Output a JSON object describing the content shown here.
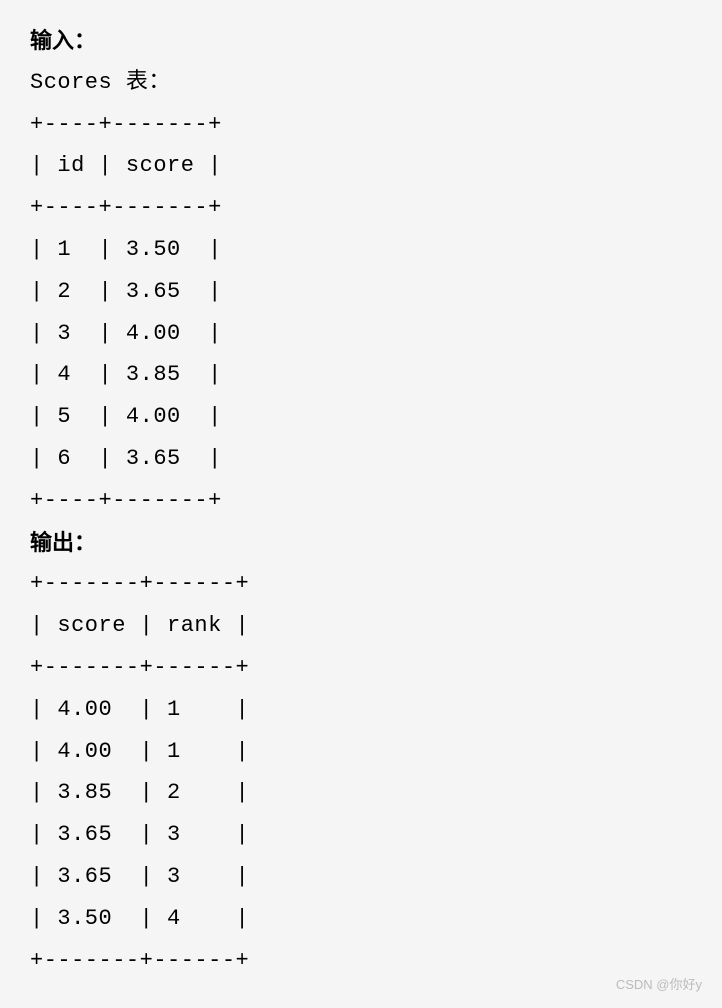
{
  "section1": {
    "heading": "输入：",
    "table_label": "Scores 表：",
    "divider_top": "+----+-------+",
    "header_row": "| id | score |",
    "divider_mid": "+----+-------+",
    "rows": [
      "| 1  | 3.50  |",
      "| 2  | 3.65  |",
      "| 3  | 4.00  |",
      "| 4  | 3.85  |",
      "| 5  | 4.00  |",
      "| 6  | 3.65  |"
    ],
    "divider_bot": "+----+-------+"
  },
  "section2": {
    "heading": "输出：",
    "divider_top": "+-------+------+",
    "header_row": "| score | rank |",
    "divider_mid": "+-------+------+",
    "rows": [
      "| 4.00  | 1    |",
      "| 4.00  | 1    |",
      "| 3.85  | 2    |",
      "| 3.65  | 3    |",
      "| 3.65  | 3    |",
      "| 3.50  | 4    |"
    ],
    "divider_bot": "+-------+------+"
  },
  "watermark": "CSDN @你好y"
}
